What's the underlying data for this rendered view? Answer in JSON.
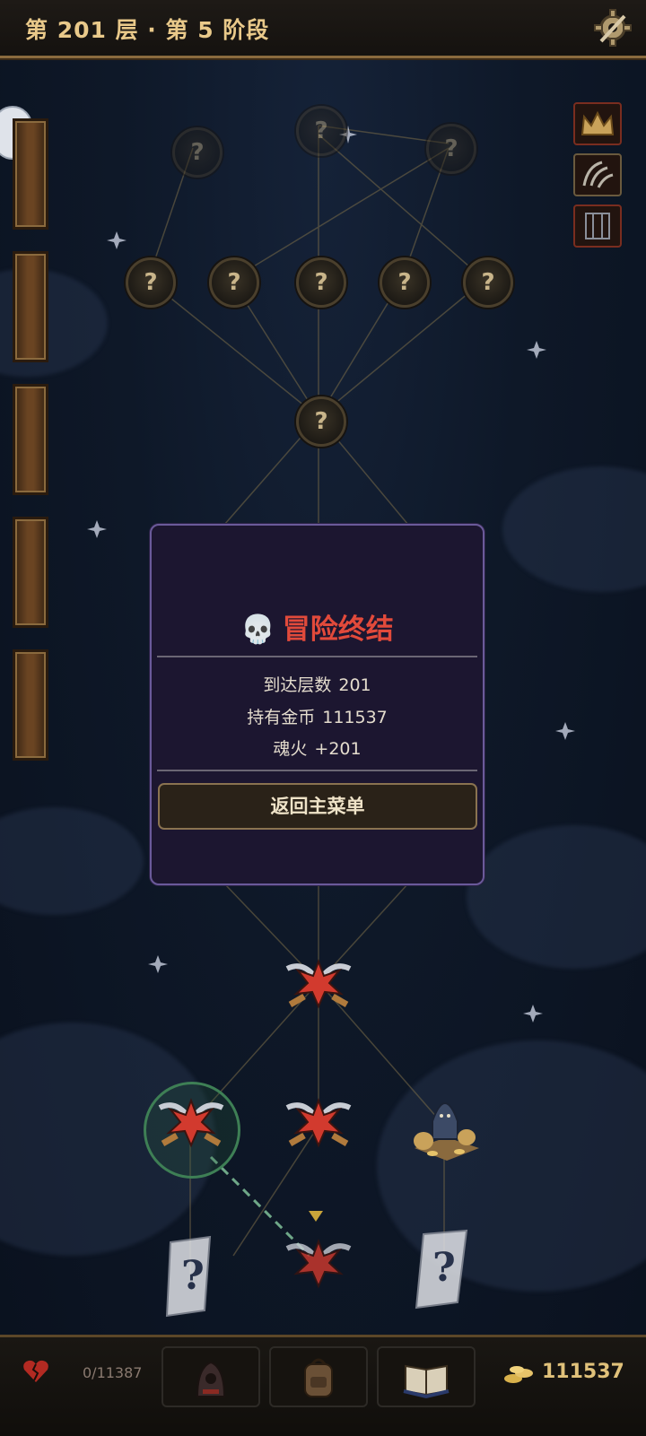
{
  "header": {
    "title": "第 201 层 · 第 5 阶段"
  },
  "map": {
    "unknown_symbol": "?",
    "nodes": [
      {
        "kind": "unknown-faint",
        "icon": "unknown-node-icon"
      },
      {
        "kind": "unknown-faint",
        "icon": "unknown-node-icon"
      },
      {
        "kind": "unknown-faint",
        "icon": "unknown-node-icon"
      },
      {
        "kind": "unknown",
        "icon": "unknown-node-icon"
      },
      {
        "kind": "unknown",
        "icon": "unknown-node-icon"
      },
      {
        "kind": "unknown",
        "icon": "unknown-node-icon"
      },
      {
        "kind": "unknown",
        "icon": "unknown-node-icon"
      },
      {
        "kind": "unknown",
        "icon": "unknown-node-icon"
      },
      {
        "kind": "unknown",
        "icon": "unknown-node-icon"
      },
      {
        "kind": "battle",
        "icon": "crossed-swords-icon"
      },
      {
        "kind": "battle",
        "icon": "crossed-swords-icon"
      },
      {
        "kind": "battle",
        "icon": "crossed-swords-icon"
      },
      {
        "kind": "merchant",
        "icon": "merchant-icon"
      },
      {
        "kind": "event",
        "icon": "scroll-event-icon"
      },
      {
        "kind": "battle",
        "icon": "crossed-swords-icon"
      },
      {
        "kind": "event",
        "icon": "scroll-event-icon"
      }
    ]
  },
  "relics": [
    {
      "icon": "crown-icon"
    },
    {
      "icon": "claw-icon"
    },
    {
      "icon": "gate-icon"
    }
  ],
  "modal": {
    "title": "冒险终结",
    "skull_icon": "💀",
    "stats": [
      {
        "label": "到达层数",
        "value": "201"
      },
      {
        "label": "持有金币",
        "value": "111537"
      },
      {
        "label": "魂火",
        "value": "+201"
      }
    ],
    "button": "返回主菜单"
  },
  "bottom": {
    "hp": "0/11387",
    "gold": "111537",
    "slots": [
      {
        "icon": "hooded-figure-icon"
      },
      {
        "icon": "backpack-icon"
      },
      {
        "icon": "book-icon"
      }
    ]
  },
  "colors": {
    "accent": "#e9c98a",
    "danger": "#e24a3b",
    "modal_border": "#6a5a9a"
  }
}
